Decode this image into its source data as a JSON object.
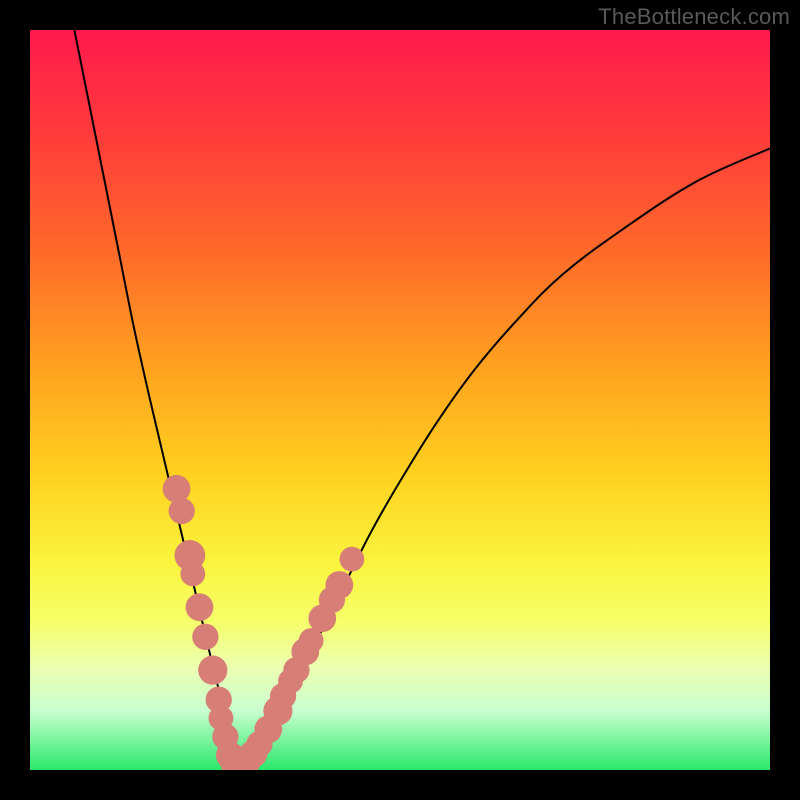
{
  "watermark": "TheBottleneck.com",
  "colors": {
    "frame": "#000000",
    "marker": "#d77f76",
    "curve": "#000000",
    "gradient_top": "#ff1a4d",
    "gradient_bottom": "#29e86a"
  },
  "chart_data": {
    "type": "line",
    "title": "",
    "xlabel": "",
    "ylabel": "",
    "xlim": [
      0,
      100
    ],
    "ylim": [
      0,
      100
    ],
    "grid": false,
    "legend": false,
    "x_min_at": 27,
    "series": [
      {
        "name": "bottleneck-curve",
        "x": [
          6,
          8,
          10,
          12,
          14,
          16,
          18,
          20,
          22,
          24,
          26,
          27,
          28,
          30,
          32,
          35,
          38,
          42,
          46,
          50,
          55,
          60,
          66,
          72,
          80,
          90,
          100
        ],
        "y": [
          100,
          90,
          80,
          70,
          60,
          51,
          42.5,
          34,
          25.5,
          17,
          8.5,
          1,
          1,
          2,
          5,
          10,
          16,
          24,
          32,
          39,
          47,
          54,
          61,
          67,
          73,
          79.5,
          84
        ]
      }
    ],
    "markers": [
      {
        "x": 19.8,
        "y": 38,
        "r": 1.2
      },
      {
        "x": 20.5,
        "y": 35,
        "r": 1.1
      },
      {
        "x": 21.6,
        "y": 29,
        "r": 1.4
      },
      {
        "x": 22.0,
        "y": 26.5,
        "r": 1.0
      },
      {
        "x": 22.9,
        "y": 22,
        "r": 1.2
      },
      {
        "x": 23.7,
        "y": 18,
        "r": 1.1
      },
      {
        "x": 24.7,
        "y": 13.5,
        "r": 1.3
      },
      {
        "x": 25.5,
        "y": 9.5,
        "r": 1.1
      },
      {
        "x": 25.8,
        "y": 7,
        "r": 1.0
      },
      {
        "x": 26.4,
        "y": 4.5,
        "r": 1.1
      },
      {
        "x": 27.0,
        "y": 2,
        "r": 1.2
      },
      {
        "x": 28.0,
        "y": 1,
        "r": 1.6
      },
      {
        "x": 29.2,
        "y": 1.2,
        "r": 1.3
      },
      {
        "x": 30.2,
        "y": 2.2,
        "r": 1.2
      },
      {
        "x": 31.0,
        "y": 3.5,
        "r": 1.1
      },
      {
        "x": 32.2,
        "y": 5.5,
        "r": 1.2
      },
      {
        "x": 33.5,
        "y": 8,
        "r": 1.3
      },
      {
        "x": 34.2,
        "y": 10,
        "r": 1.1
      },
      {
        "x": 35.2,
        "y": 12,
        "r": 1.0
      },
      {
        "x": 36.0,
        "y": 13.5,
        "r": 1.1
      },
      {
        "x": 37.2,
        "y": 16,
        "r": 1.2
      },
      {
        "x": 38.0,
        "y": 17.5,
        "r": 1.0
      },
      {
        "x": 39.5,
        "y": 20.5,
        "r": 1.2
      },
      {
        "x": 40.8,
        "y": 23,
        "r": 1.1
      },
      {
        "x": 41.8,
        "y": 25,
        "r": 1.2
      },
      {
        "x": 43.5,
        "y": 28.5,
        "r": 1.0
      }
    ]
  }
}
